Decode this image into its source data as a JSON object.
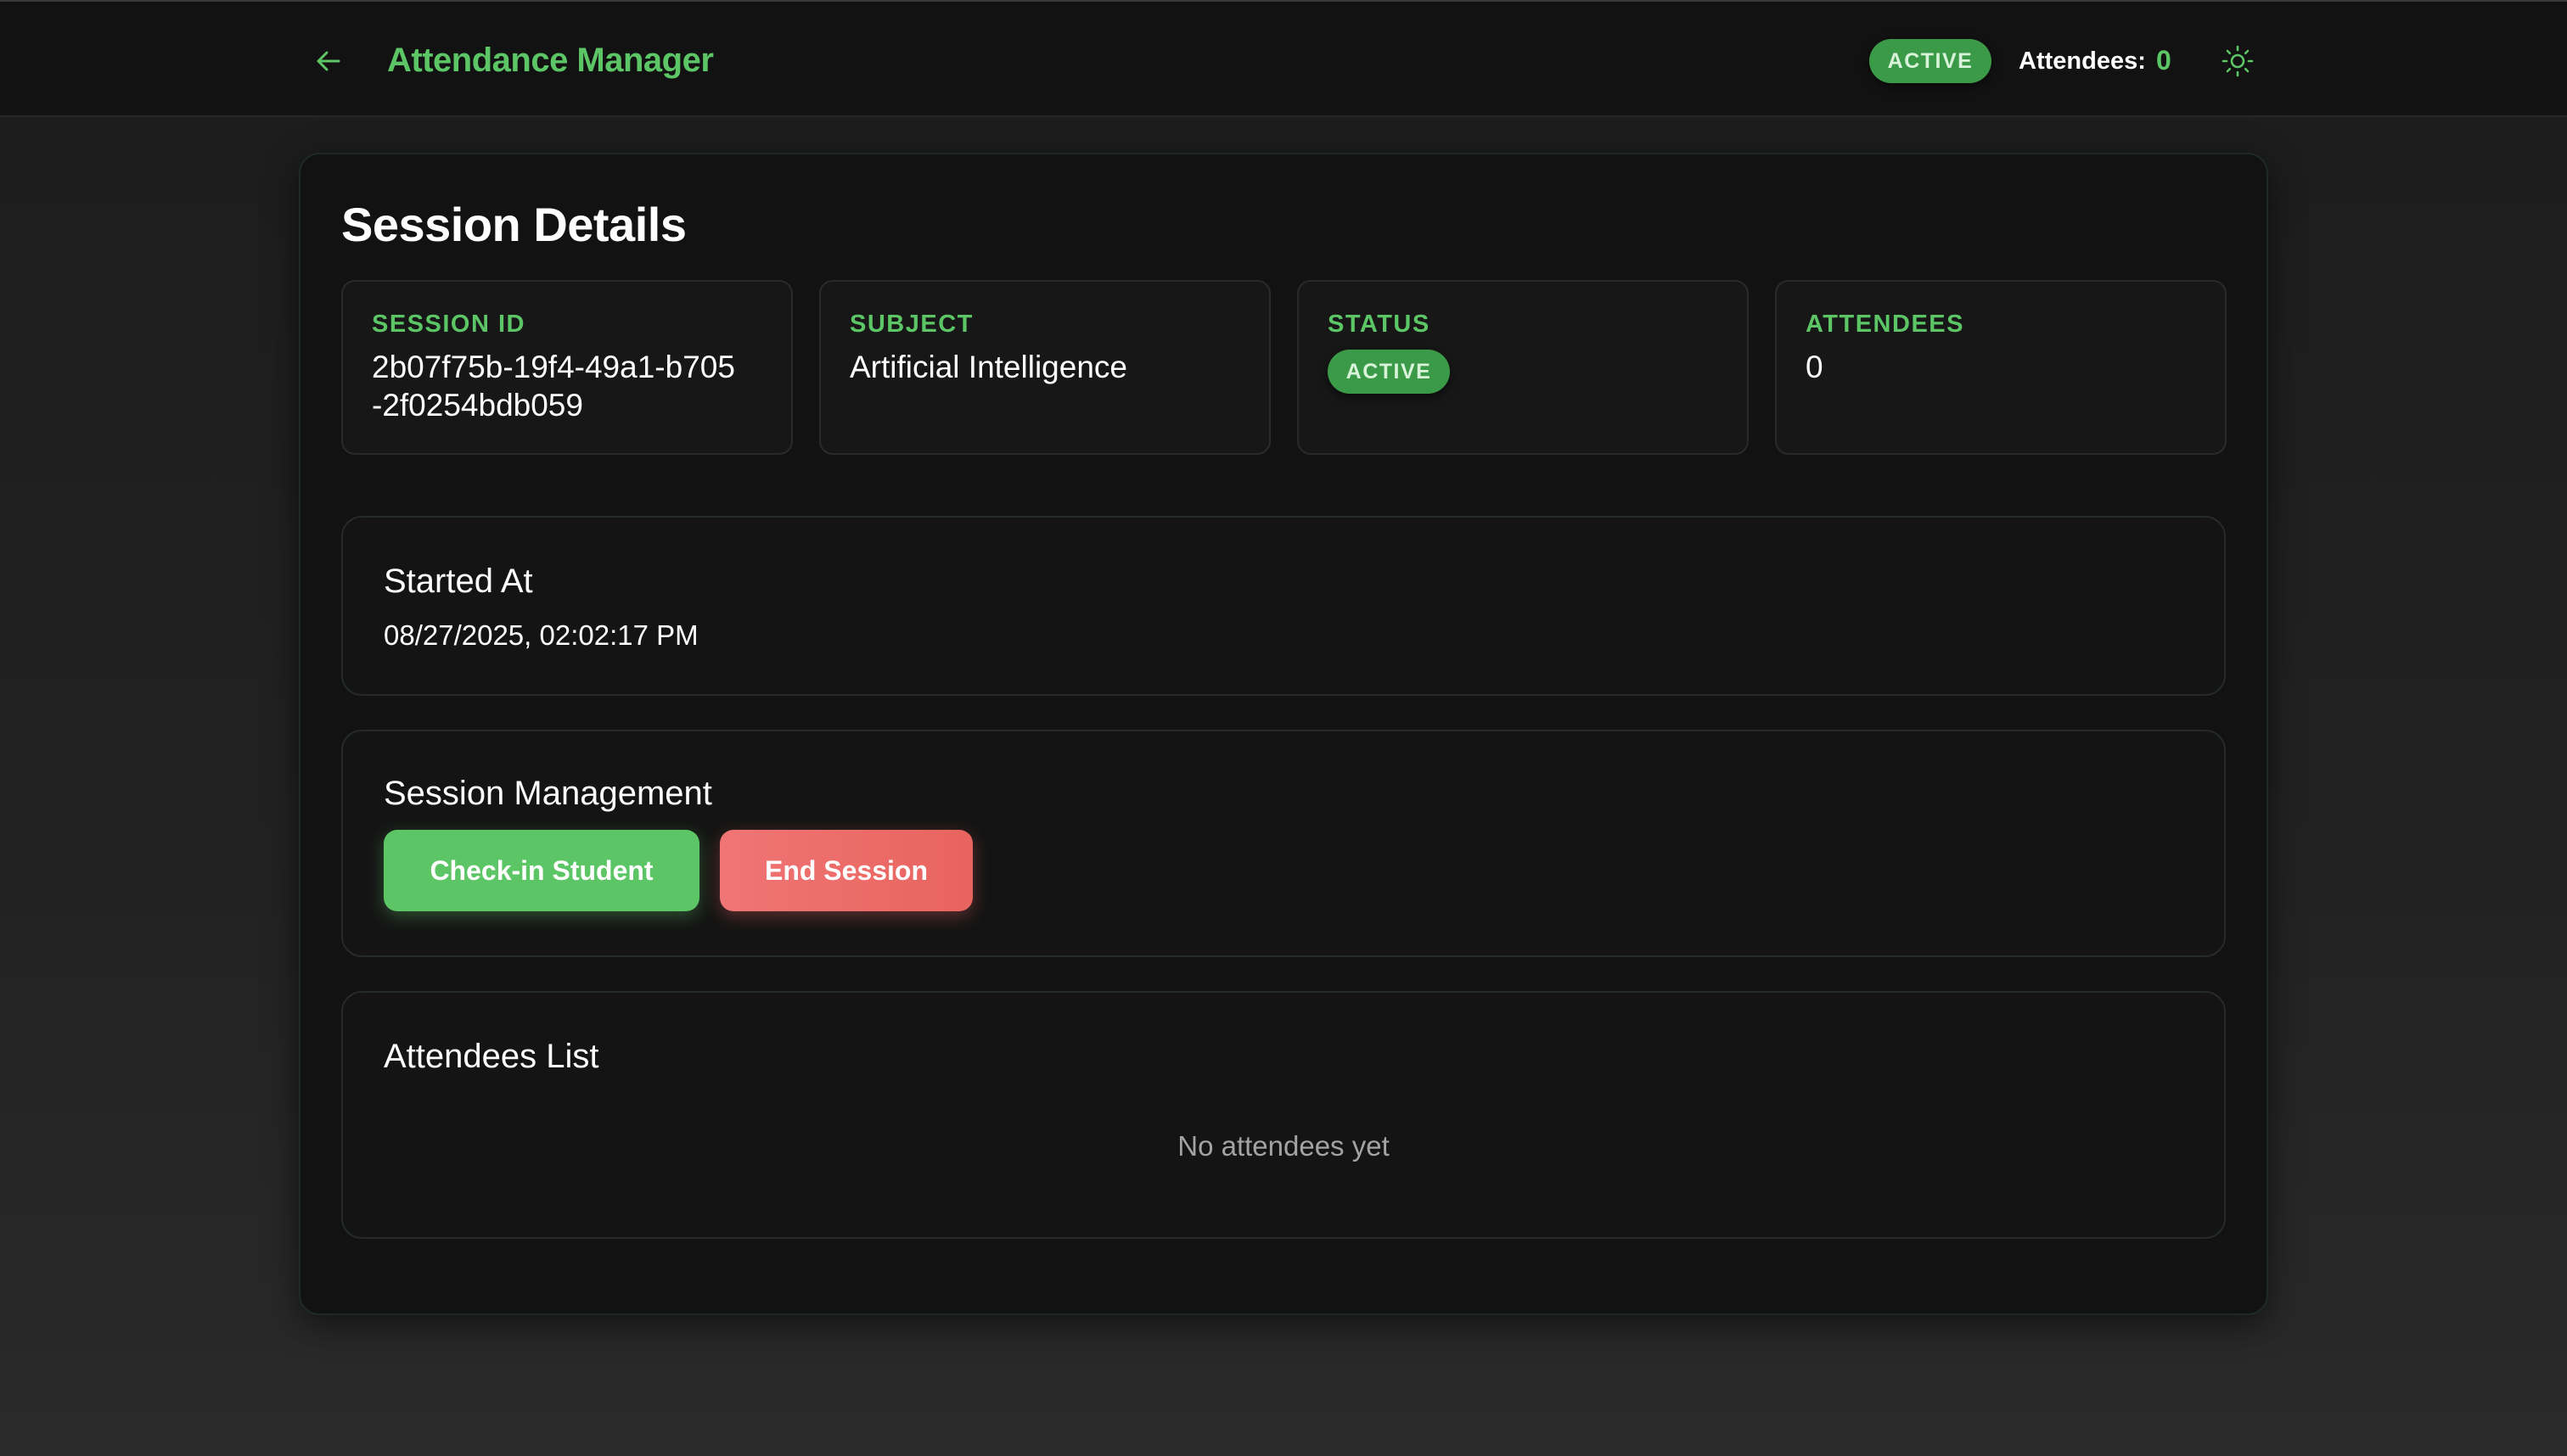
{
  "header": {
    "title": "Attendance Manager",
    "status_badge": "ACTIVE",
    "attendees_label": "Attendees:",
    "attendees_count": "0",
    "accent_color": "#5cc565",
    "back_icon": "arrow-left-icon",
    "theme_icon": "sun-icon"
  },
  "session": {
    "title": "Session Details",
    "fields": {
      "session_id": {
        "label": "SESSION ID",
        "value": "2b07f75b-19f4-49a1-b705-2f0254bdb059"
      },
      "subject": {
        "label": "SUBJECT",
        "value": "Artificial Intelligence"
      },
      "status": {
        "label": "STATUS",
        "value": "ACTIVE"
      },
      "attendees": {
        "label": "ATTENDEES",
        "value": "0"
      }
    }
  },
  "started": {
    "title": "Started At",
    "value": "08/27/2025, 02:02:17 PM"
  },
  "management": {
    "title": "Session Management",
    "checkin_label": "Check-in Student",
    "end_label": "End Session",
    "checkin_color": "#5cc565",
    "end_color": "#f07575"
  },
  "attendees_list": {
    "title": "Attendees List",
    "empty_text": "No attendees yet",
    "items": []
  }
}
